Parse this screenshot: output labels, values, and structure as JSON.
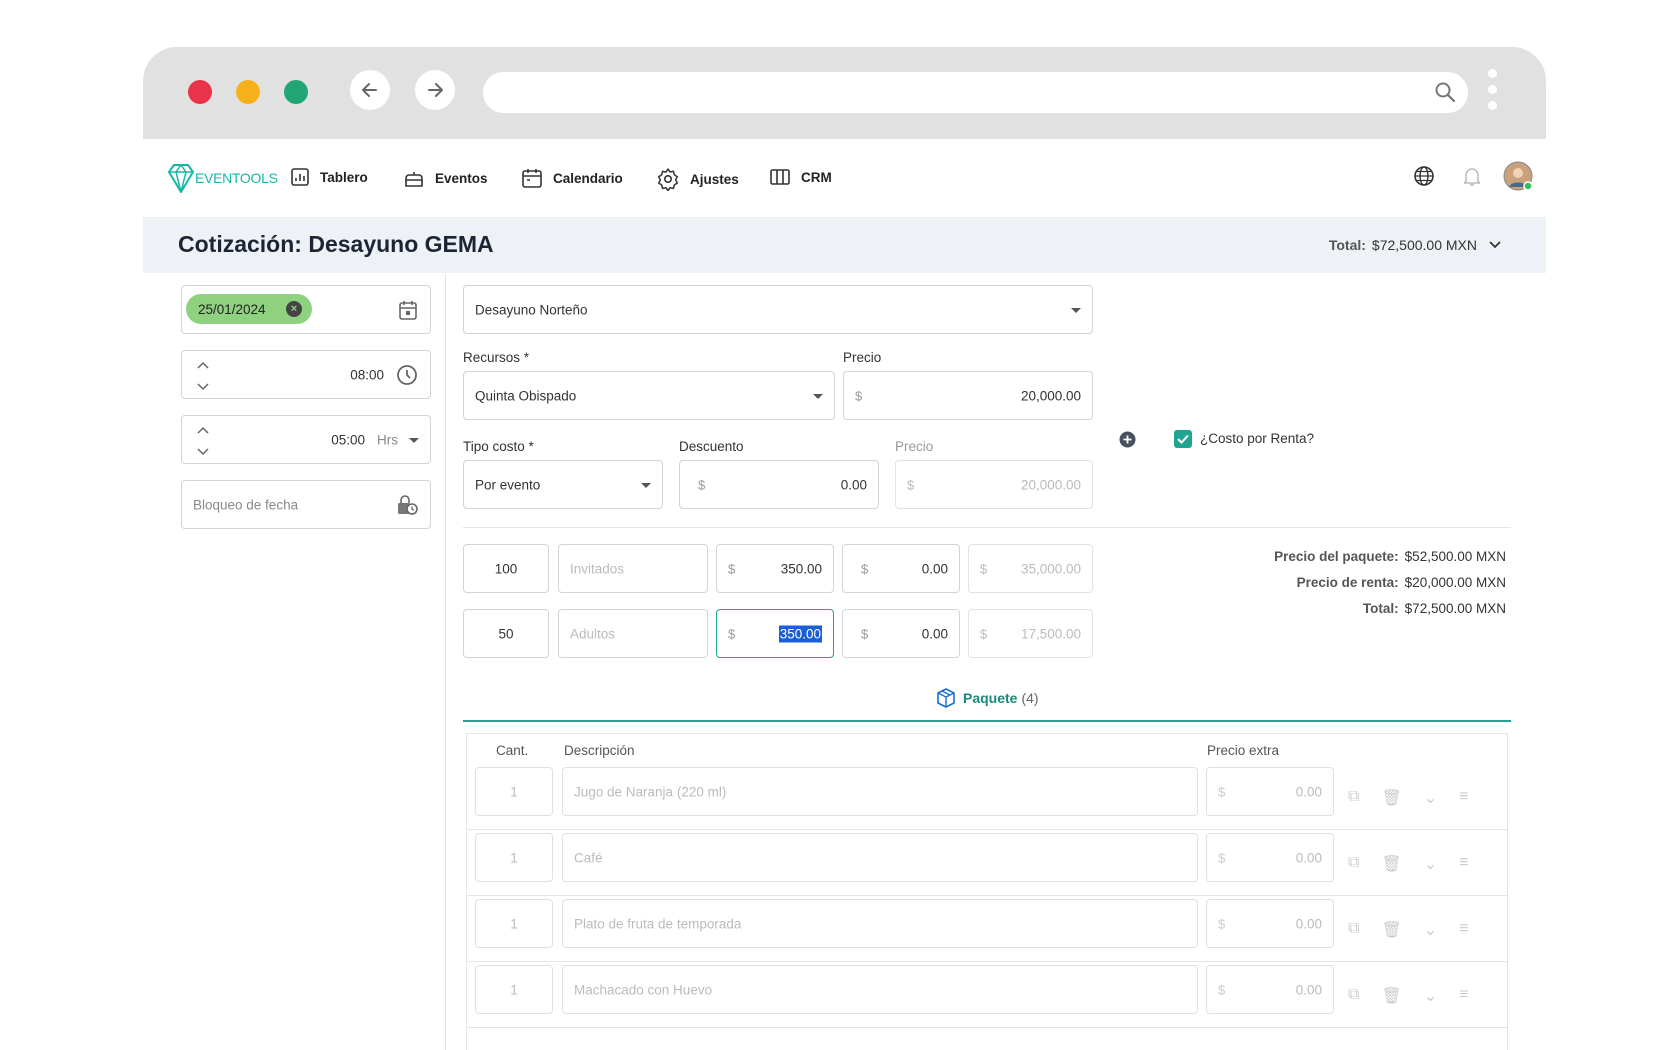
{
  "nav": {
    "logo_text": "EVENTOOLS",
    "items": [
      {
        "label": "Tablero"
      },
      {
        "label": "Eventos"
      },
      {
        "label": "Calendario"
      },
      {
        "label": "Ajustes"
      },
      {
        "label": "CRM"
      }
    ]
  },
  "header": {
    "title": "Cotización: Desayuno GEMA",
    "total_label": "Total:",
    "total_value": "$72,500.00 MXN"
  },
  "left": {
    "date_chip": "25/01/2024",
    "time": "08:00",
    "duration": "05:00",
    "duration_unit": "Hrs",
    "date_block_placeholder": "Bloqueo de fecha"
  },
  "form": {
    "package_select": "Desayuno Norteño",
    "recursos_label": "Recursos *",
    "recursos_value": "Quinta Obispado",
    "precio_label": "Precio",
    "precio_currency": "$",
    "precio_value": "20,000.00",
    "tipo_costo_label": "Tipo costo *",
    "tipo_costo_value": "Por evento",
    "descuento_label": "Descuento",
    "descuento_currency": "$",
    "descuento_value": "0.00",
    "precio2_label": "Precio",
    "precio2_currency": "$",
    "precio2_value": "20,000.00",
    "costo_renta_label": "¿Costo por Renta?",
    "costo_renta_checked": true
  },
  "guests": [
    {
      "qty": "100",
      "type_placeholder": "Invitados",
      "currency": "$",
      "unit_price": "350.00",
      "discount": "0.00",
      "total": "35,000.00"
    },
    {
      "qty": "50",
      "type_placeholder": "Adultos",
      "currency": "$",
      "unit_price": "350.00",
      "discount": "0.00",
      "total": "17,500.00"
    }
  ],
  "summary": {
    "package_label": "Precio del paquete:",
    "package_value": "$52,500.00 MXN",
    "rent_label": "Precio de renta:",
    "rent_value": "$20,000.00 MXN",
    "total_label": "Total:",
    "total_value": "$72,500.00 MXN"
  },
  "package_tab": {
    "label": "Paquete",
    "count": "(4)"
  },
  "table": {
    "headers": {
      "qty": "Cant.",
      "desc": "Descripción",
      "extra": "Precio extra"
    },
    "rows": [
      {
        "qty": "1",
        "desc": "Jugo de Naranja (220 ml)",
        "currency": "$",
        "extra": "0.00"
      },
      {
        "qty": "1",
        "desc": "Café",
        "currency": "$",
        "extra": "0.00"
      },
      {
        "qty": "1",
        "desc": "Plato de fruta de temporada",
        "currency": "$",
        "extra": "0.00"
      },
      {
        "qty": "1",
        "desc": "Machacado con Huevo",
        "currency": "$",
        "extra": "0.00"
      }
    ]
  },
  "colors": {
    "accent": "#1fa592",
    "chip": "#8ed27f",
    "traffic_red": "#e8334a",
    "traffic_yellow": "#f7b21b",
    "traffic_green": "#22a675"
  }
}
